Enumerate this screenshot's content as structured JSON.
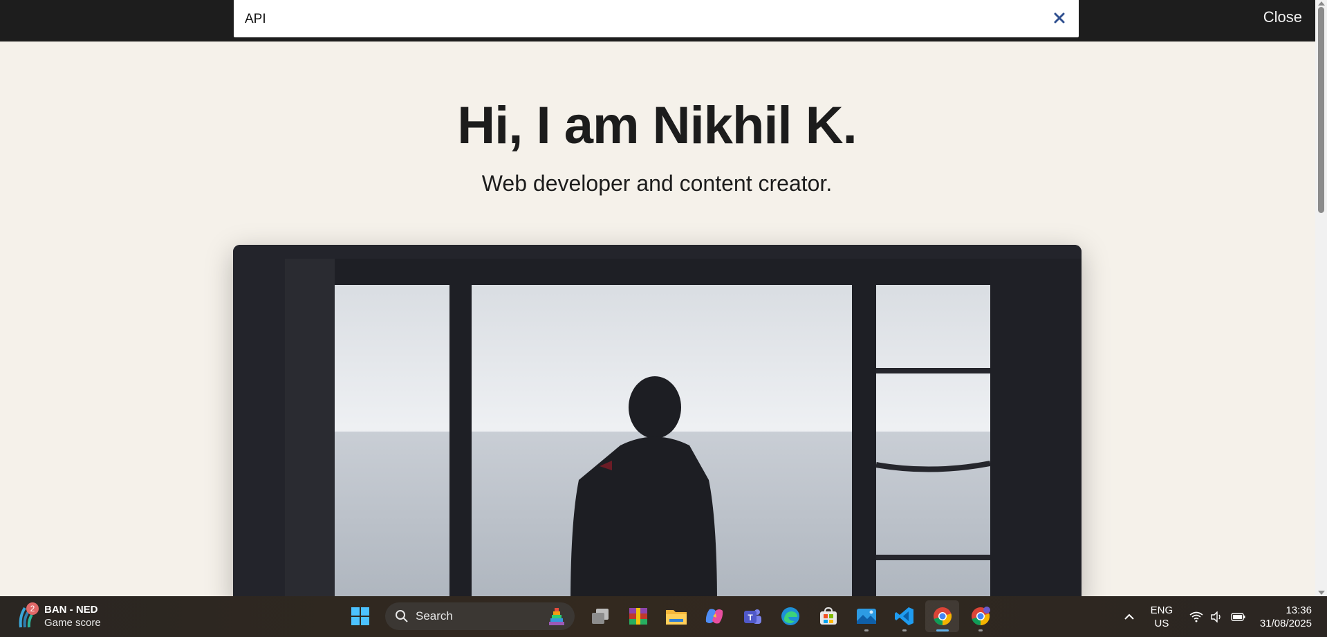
{
  "search": {
    "value": "API",
    "clear_label": "×",
    "close_label": "Close"
  },
  "hero": {
    "title": "Hi, I am Nikhil K.",
    "subtitle": "Web developer and content creator."
  },
  "taskbar": {
    "widget": {
      "badge": "2",
      "title": "BAN - NED",
      "subtitle": "Game score"
    },
    "search_label": "Search",
    "lang": {
      "line1": "ENG",
      "line2": "US"
    },
    "clock": {
      "time": "13:36",
      "date": "31/08/2025"
    },
    "apps": [
      "start-icon",
      "task-view-icon",
      "winrar-icon",
      "file-explorer-icon",
      "copilot-icon",
      "teams-icon",
      "edge-icon",
      "microsoft-store-icon",
      "photos-icon",
      "vscode-icon",
      "chrome-icon",
      "chrome-profile-icon"
    ]
  },
  "colors": {
    "topbar": "#1d1d1d",
    "page_bg": "#f5f1ea",
    "clear_icon": "#2f4f8f"
  }
}
